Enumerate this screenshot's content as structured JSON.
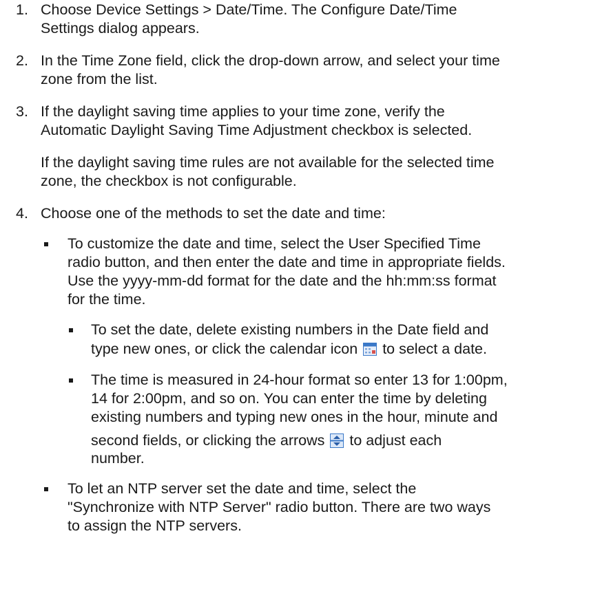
{
  "steps": [
    {
      "number": "1.",
      "lines": [
        "Choose Device Settings > Date/Time. The Configure Date/Time",
        "Settings dialog appears."
      ]
    },
    {
      "number": "2.",
      "lines": [
        "In the Time Zone field, click the drop-down arrow, and select your time",
        "zone from the list."
      ]
    },
    {
      "number": "3.",
      "lines": [
        "If the daylight saving time applies to your time zone, verify the",
        "Automatic Daylight Saving Time Adjustment checkbox is selected."
      ],
      "note": [
        "If the daylight saving time rules are not available for the selected time",
        "zone, the checkbox is not configurable."
      ]
    },
    {
      "number": "4.",
      "lines": [
        "Choose one of the methods to set the date and time:"
      ]
    }
  ],
  "methods": [
    {
      "lines": [
        "To customize the date and time, select the User Specified Time",
        "radio button, and then enter the date and time in appropriate fields.",
        "Use the yyyy-mm-dd format for the date and the hh:mm:ss format",
        "for the time."
      ],
      "subitems": [
        {
          "line1": "To set the date, delete existing numbers in the Date field and",
          "line2_before": "type new ones, or click the calendar icon",
          "line2_after": "to select a date.",
          "icon": "calendar-icon"
        },
        {
          "line1": "The time is measured in 24-hour format so enter 13 for 1:00pm,",
          "line2": "14 for 2:00pm, and so on. You can enter the time by deleting",
          "line3": "existing numbers and typing new ones in the hour, minute and",
          "line4_before": "second fields, or clicking the arrows",
          "line4_after": "to adjust each",
          "line5": "number.",
          "icon": "spin-arrows-icon"
        }
      ]
    },
    {
      "lines": [
        "To let an NTP server set the date and time, select the",
        "\"Synchronize with NTP Server\" radio button. There are two ways",
        "to assign the NTP servers."
      ]
    }
  ],
  "colors": {
    "text": "#1a1a1a",
    "icon_blue": "#3a78c8",
    "icon_light": "#e6eefb"
  }
}
